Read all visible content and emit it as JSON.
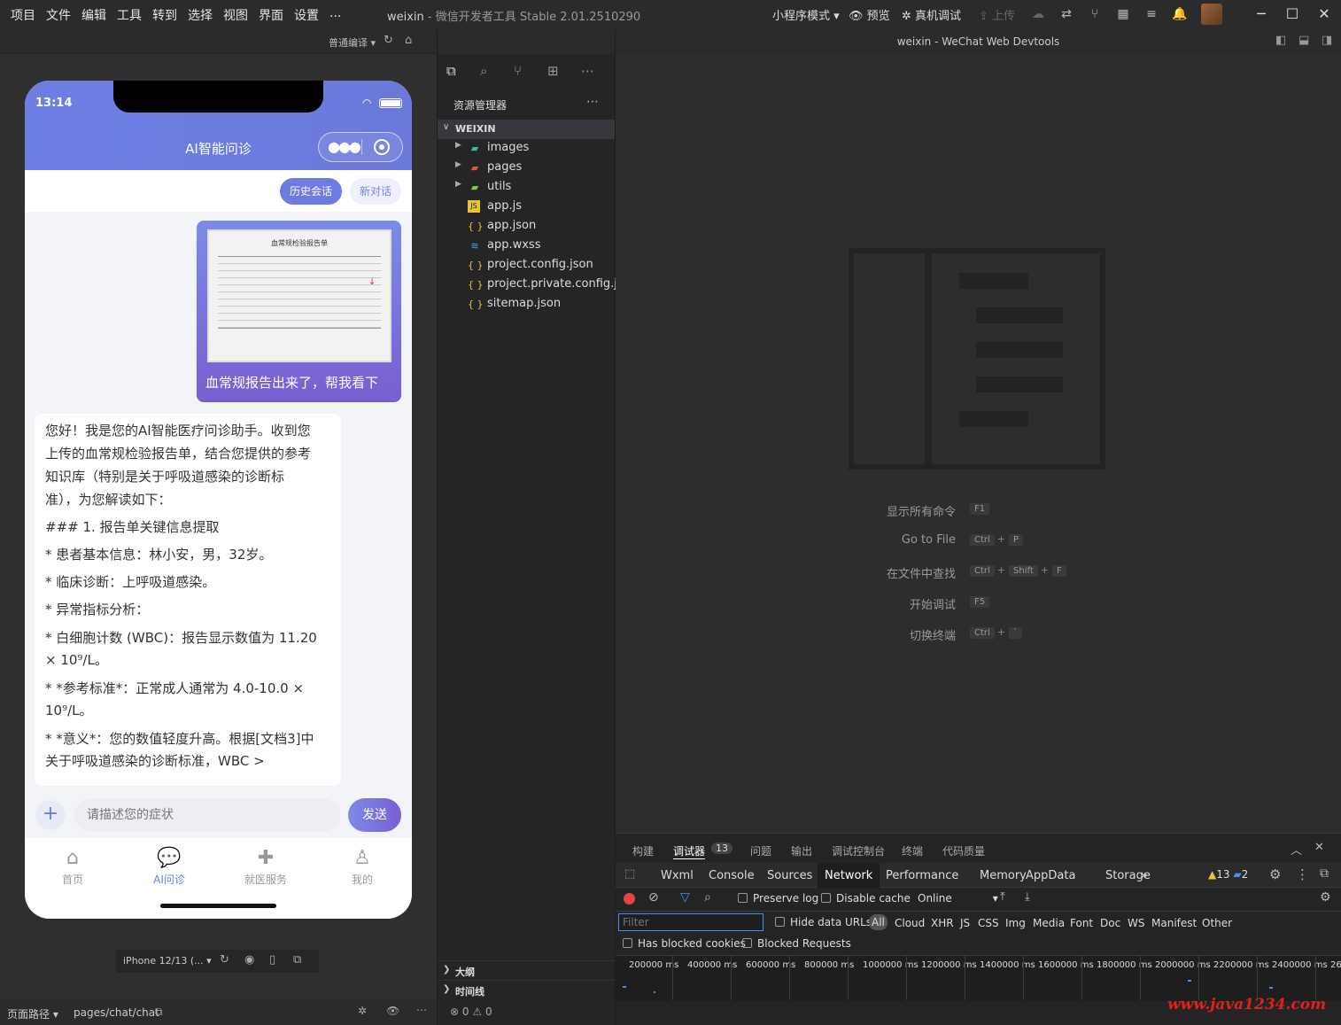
{
  "titlebar": {
    "menus": [
      "项目",
      "文件",
      "编辑",
      "工具",
      "转到",
      "选择",
      "视图",
      "界面",
      "设置",
      "..."
    ],
    "app_name": "weixin",
    "app_version": " - 微信开发者工具 Stable 2.01.2510290",
    "mode": "小程序模式 ▾",
    "preview": "预览",
    "real_debug": "真机调试",
    "upload": "上传"
  },
  "simulator": {
    "compile_mode": "普通编译 ▾",
    "status_time": "13:14",
    "nav_title": "AI智能问诊",
    "history_btn": "历史会话",
    "new_chat_btn": "新对话",
    "report_title": "血常规检验报告单",
    "user_message": "血常规报告出来了，帮我看下",
    "bot_lines": [
      "您好！我是您的AI智能医疗问诊助手。收到您",
      "上传的血常规检验报告单，结合您提供的参考",
      "知识库（特别是关于呼吸道感染的诊断标",
      "准），为您解读如下：",
      "### 1. 报告单关键信息提取",
      "*   患者基本信息：林小安，男，32岁。",
      "*   临床诊断：上呼吸道感染。",
      "*   异常指标分析：",
      "*   白细胞计数 (WBC)：报告显示数值为 11.20",
      "× 10⁹/L。",
      "*   *参考标准*：正常成人通常为 4.0-10.0 ×",
      "10⁹/L。",
      "*   *意义*：您的数值轻度升高。根据[文档3]中",
      "关于呼吸道感染的诊断标准，WBC >"
    ],
    "input_placeholder": "请描述您的症状",
    "send_btn": "发送",
    "tabs": [
      {
        "icon": "home-icon",
        "label": "首页"
      },
      {
        "icon": "chat-icon",
        "label": "AI问诊"
      },
      {
        "icon": "medical-cross-icon",
        "label": "就医服务"
      },
      {
        "icon": "user-icon",
        "label": "我的"
      }
    ],
    "device": "iPhone 12/13 (... ▾"
  },
  "statusbar": {
    "path_label": "页面路径 ▾",
    "path": "pages/chat/chat",
    "errors": "0",
    "warnings": "0"
  },
  "explorer": {
    "title": "资源管理器",
    "root": "WEIXIN",
    "items": [
      {
        "name": "images",
        "type": "folder",
        "color": "#3fb8a6"
      },
      {
        "name": "pages",
        "type": "folder",
        "color": "#e2583e"
      },
      {
        "name": "utils",
        "type": "folder",
        "color": "#8bc34a"
      },
      {
        "name": "app.js",
        "type": "js",
        "color": "#e8c43a"
      },
      {
        "name": "app.json",
        "type": "json",
        "color": "#e8c43a"
      },
      {
        "name": "app.wxss",
        "type": "css",
        "color": "#4aa3e8"
      },
      {
        "name": "project.config.json",
        "type": "json",
        "color": "#e8c43a"
      },
      {
        "name": "project.private.config.js...",
        "type": "json",
        "color": "#e8c43a"
      },
      {
        "name": "sitemap.json",
        "type": "json",
        "color": "#e8c43a"
      }
    ],
    "outline": "大纲",
    "timeline": "时间线"
  },
  "editor": {
    "title": "weixin - WeChat Web Devtools",
    "commands": [
      {
        "label": "显示所有命令",
        "keys": [
          "F1"
        ]
      },
      {
        "label": "Go to File",
        "keys": [
          "Ctrl",
          "+",
          "P"
        ]
      },
      {
        "label": "在文件中查找",
        "keys": [
          "Ctrl",
          "+",
          "Shift",
          "+",
          "F"
        ]
      },
      {
        "label": "开始调试",
        "keys": [
          "F5"
        ]
      },
      {
        "label": "切换终端",
        "keys": [
          "Ctrl",
          "+",
          "`"
        ]
      }
    ]
  },
  "devtools": {
    "panel_tabs": [
      "构建",
      "调试器",
      "问题",
      "输出",
      "调试控制台",
      "终端",
      "代码质量"
    ],
    "debugger_badge": "13",
    "chrome_tabs": [
      "Wxml",
      "Console",
      "Sources",
      "Network",
      "Performance",
      "Memory",
      "AppData",
      "Storage",
      "»"
    ],
    "warn_count": "13",
    "msg_count": "2",
    "preserve_log": "Preserve log",
    "disable_cache": "Disable cache",
    "throttle": "Online",
    "filter_placeholder": "Filter",
    "hide_data_urls": "Hide data URLs",
    "types": [
      "All",
      "Cloud",
      "XHR",
      "JS",
      "CSS",
      "Img",
      "Media",
      "Font",
      "Doc",
      "WS",
      "Manifest",
      "Other"
    ],
    "has_blocked": "Has blocked cookies",
    "blocked_requests": "Blocked Requests",
    "timeline_ticks": [
      "200000 ms",
      "400000 ms",
      "600000 ms",
      "800000 ms",
      "1000000 ms",
      "1200000 ms",
      "1400000 ms",
      "1600000 ms",
      "1800000 ms",
      "2000000 ms",
      "2200000 ms",
      "2400000 ms",
      "260"
    ]
  },
  "watermark": "www.java1234.com"
}
